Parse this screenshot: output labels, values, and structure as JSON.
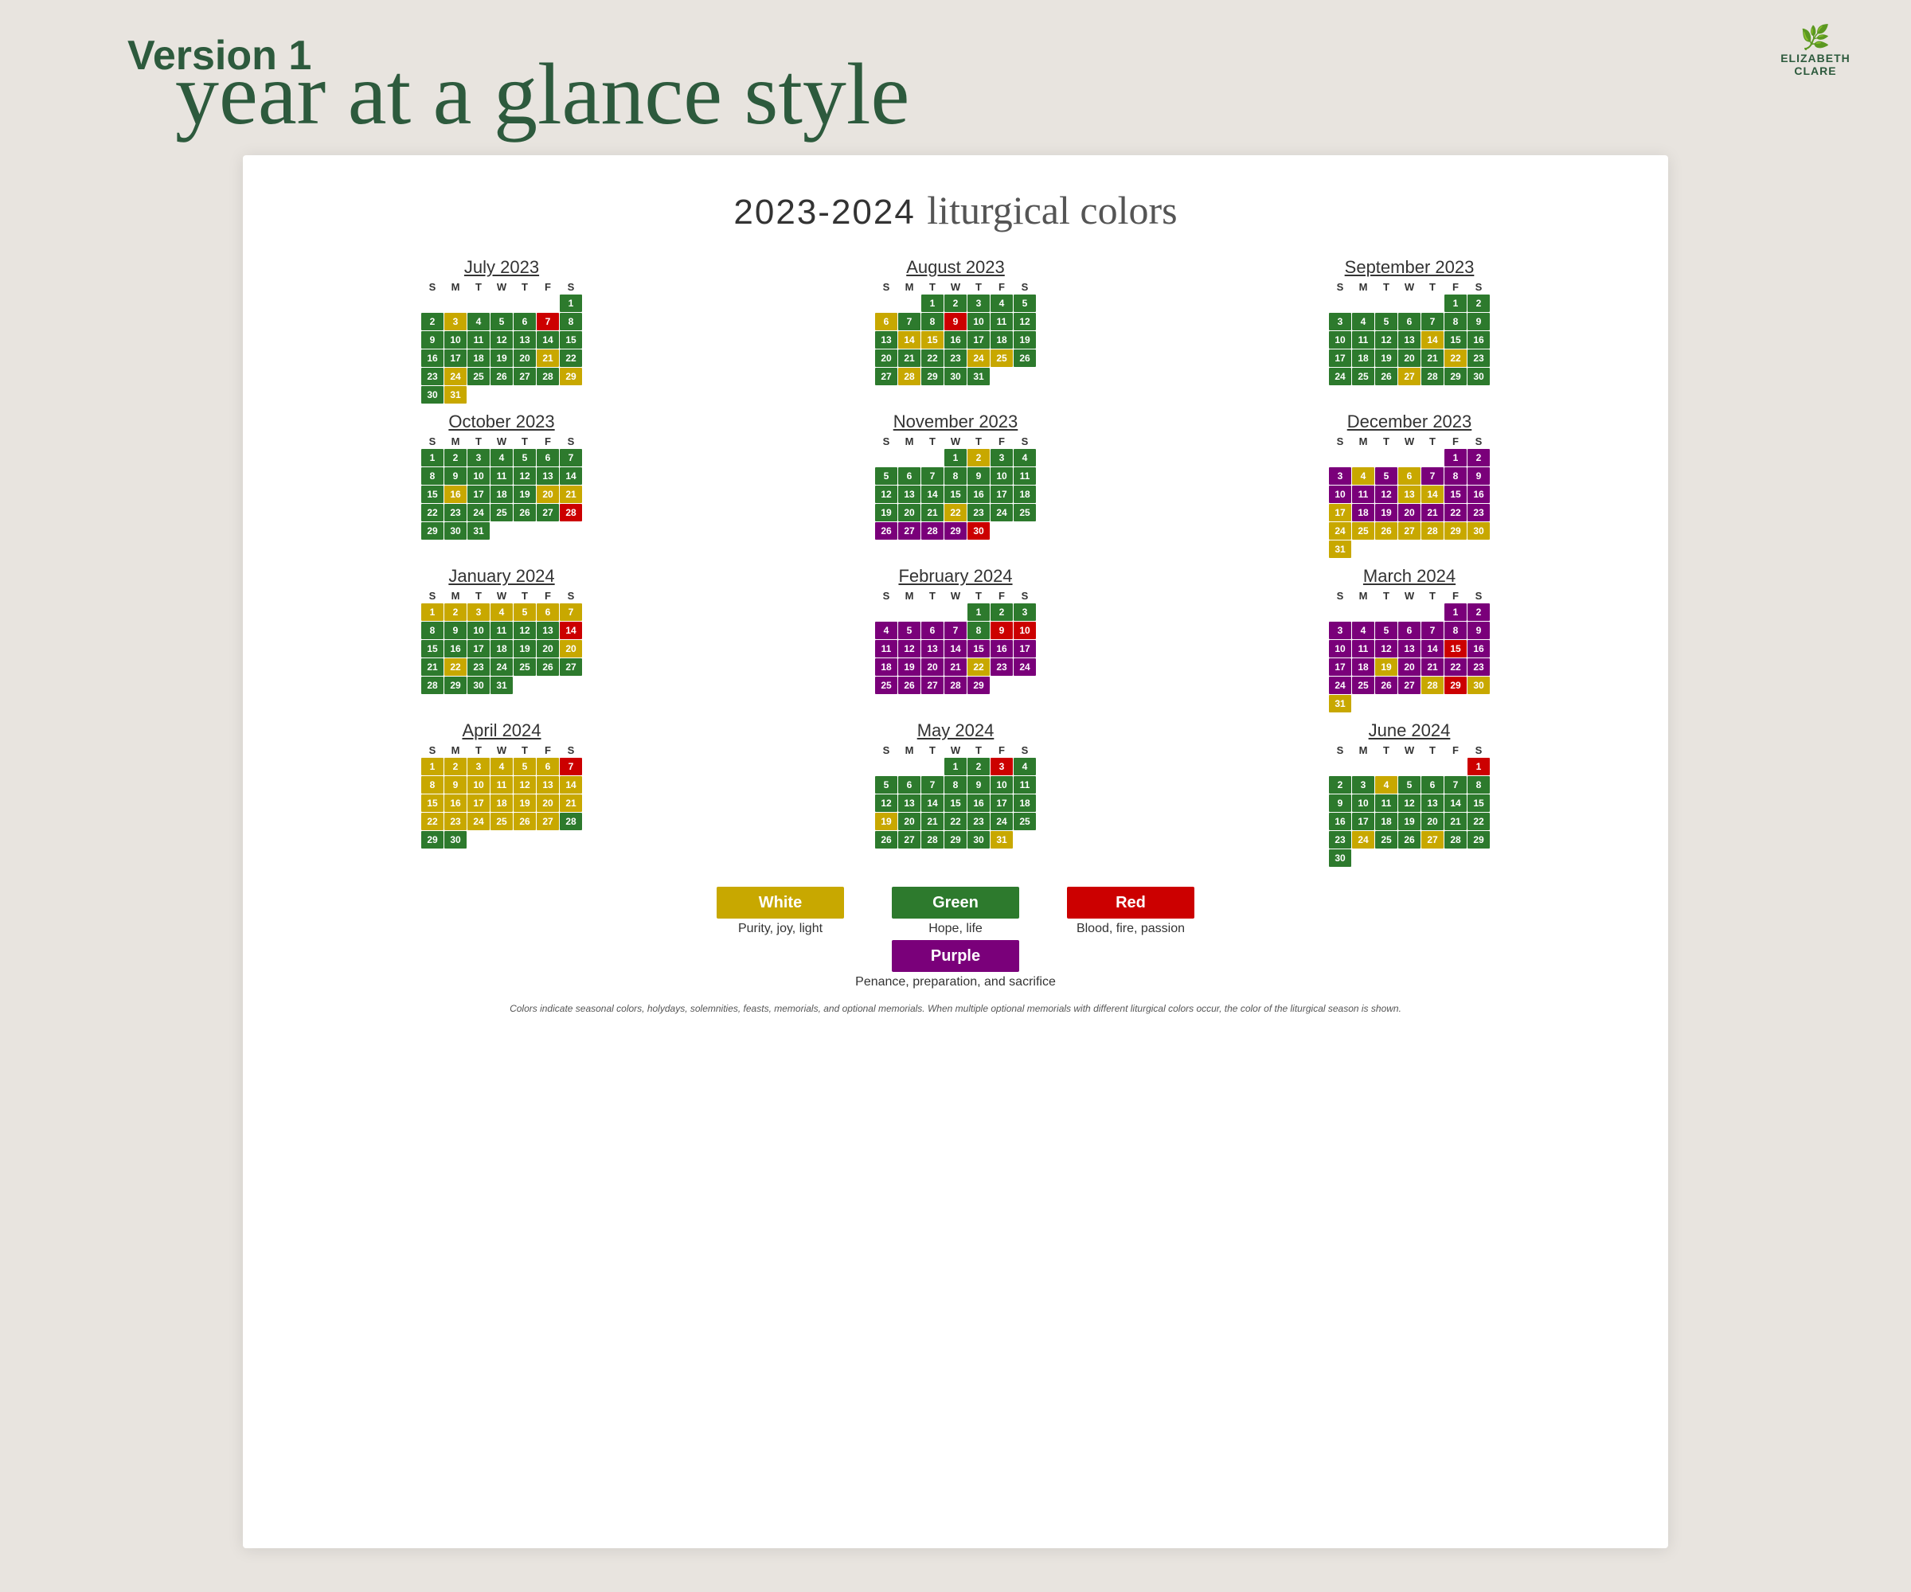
{
  "header": {
    "version": "Version 1",
    "script_title": "year at a glance style",
    "logo_text": "ELIZABETH CLARE"
  },
  "card": {
    "title_year": "2023-2024",
    "title_script": "liturgical colors"
  },
  "legend": {
    "items": [
      {
        "label": "White",
        "desc": "Purity, joy, light",
        "color": "#c8a800"
      },
      {
        "label": "Green",
        "desc": "Hope, life",
        "color": "#2d7a2d"
      },
      {
        "label": "Red",
        "desc": "Blood, fire, passion",
        "color": "#cc0000"
      }
    ],
    "purple": {
      "label": "Purple",
      "desc": "Penance, preparation, and sacrifice",
      "color": "#7a007a"
    }
  },
  "footnote": "Colors indicate seasonal colors, holydays, solemnities, feasts, memorials, and optional memorials. When multiple optional memorials with\ndifferent liturgical colors occur, the color of the liturgical season is shown."
}
